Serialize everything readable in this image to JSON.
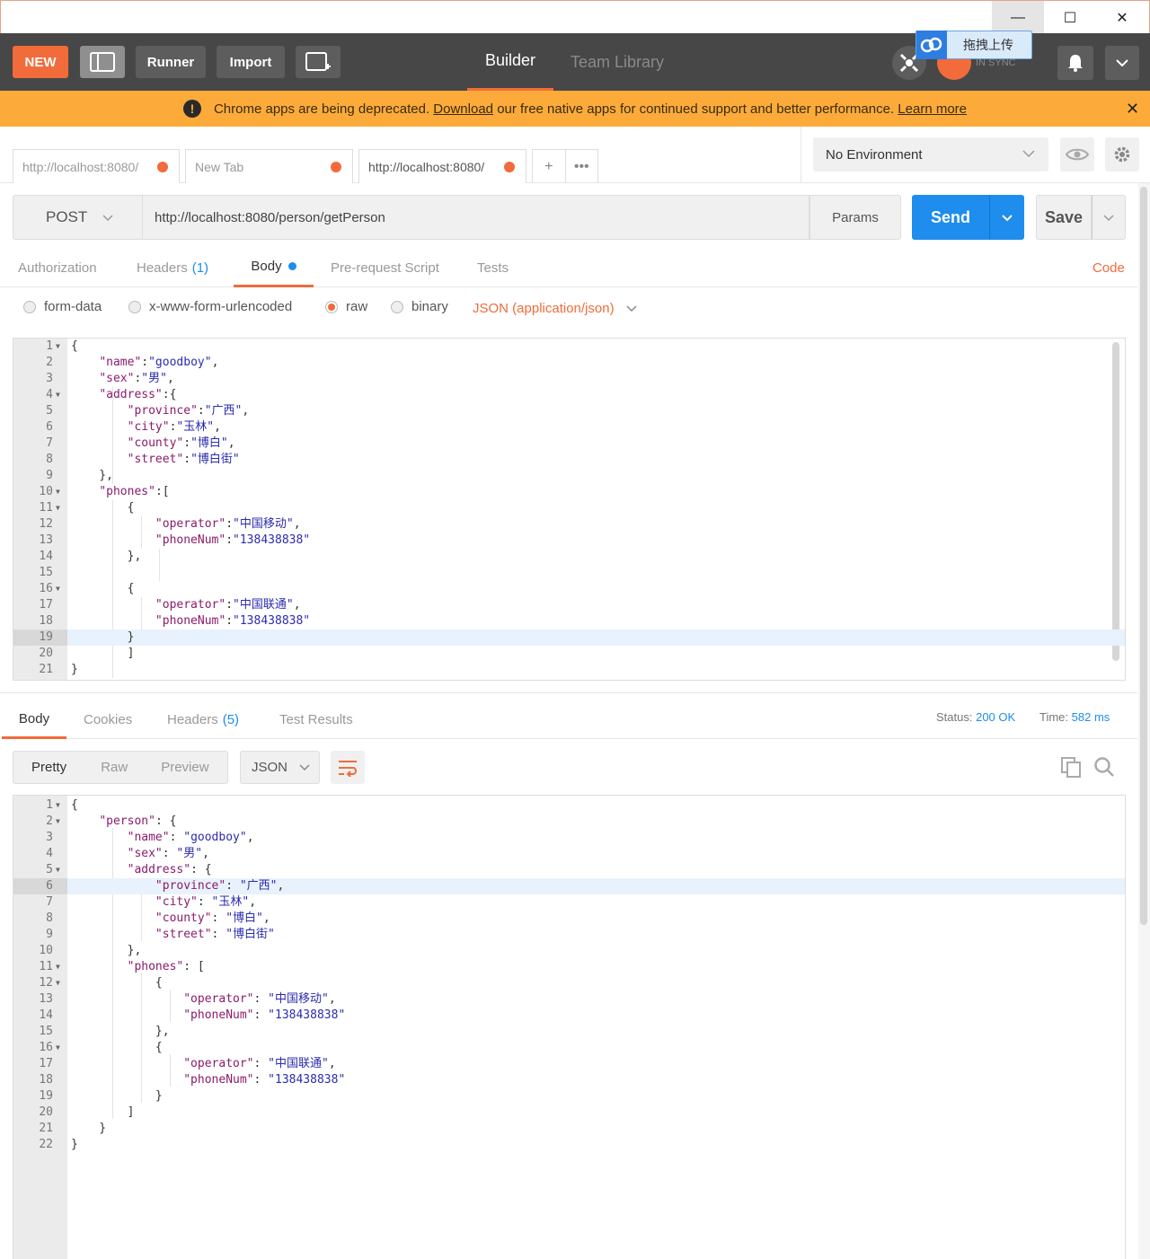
{
  "window": {
    "minimize": "—",
    "maximize": "☐",
    "close": "✕"
  },
  "header": {
    "new_label": "NEW",
    "runner_label": "Runner",
    "import_label": "Import",
    "tabs": [
      "Builder",
      "Team Library"
    ],
    "sync_text": "IN SYNC",
    "overlay_text": "拖拽上传"
  },
  "banner": {
    "text_before": "Chrome apps are being deprecated.",
    "download_link": "Download",
    "text_after": "our free native apps for continued support and better performance.",
    "learn_more": "Learn more"
  },
  "request_tabs": [
    {
      "label": "http://localhost:8080/"
    },
    {
      "label": "New Tab"
    },
    {
      "label": "http://localhost:8080/"
    }
  ],
  "environment": {
    "selected": "No Environment"
  },
  "request": {
    "method": "POST",
    "url": "http://localhost:8080/person/getPerson",
    "params_label": "Params",
    "send_label": "Send",
    "save_label": "Save"
  },
  "request_sections": {
    "authorization": "Authorization",
    "headers": "Headers",
    "headers_count": "(1)",
    "body": "Body",
    "prerequest": "Pre-request Script",
    "tests": "Tests",
    "code": "Code"
  },
  "body_modes": {
    "form_data": "form-data",
    "urlencoded": "x-www-form-urlencoded",
    "raw": "raw",
    "binary": "binary",
    "content_type": "JSON (application/json)"
  },
  "request_body_lines": [
    {
      "n": "1",
      "fold": true,
      "html": "{"
    },
    {
      "n": "2",
      "html": "    <span class='k'>\"name\"</span>:<span class='s'>\"goodboy\"</span>,"
    },
    {
      "n": "3",
      "html": "    <span class='k'>\"sex\"</span>:<span class='s'>\"男\"</span>,"
    },
    {
      "n": "4",
      "fold": true,
      "html": "    <span class='k'>\"address\"</span>:{"
    },
    {
      "n": "5",
      "html": "        <span class='k'>\"province\"</span>:<span class='s'>\"广西\"</span>,"
    },
    {
      "n": "6",
      "html": "        <span class='k'>\"city\"</span>:<span class='s'>\"玉林\"</span>,"
    },
    {
      "n": "7",
      "html": "        <span class='k'>\"county\"</span>:<span class='s'>\"博白\"</span>,"
    },
    {
      "n": "8",
      "html": "        <span class='k'>\"street\"</span>:<span class='s'>\"博白街\"</span>"
    },
    {
      "n": "9",
      "html": "    },"
    },
    {
      "n": "10",
      "fold": true,
      "html": "    <span class='k'>\"phones\"</span>:["
    },
    {
      "n": "11",
      "fold": true,
      "html": "        {"
    },
    {
      "n": "12",
      "html": "            <span class='k'>\"operator\"</span>:<span class='s'>\"中国移动\"</span>,"
    },
    {
      "n": "13",
      "html": "            <span class='k'>\"phoneNum\"</span>:<span class='s'>\"138438838\"</span>"
    },
    {
      "n": "14",
      "html": "        },"
    },
    {
      "n": "15",
      "html": ""
    },
    {
      "n": "16",
      "fold": true,
      "html": "        {"
    },
    {
      "n": "17",
      "html": "            <span class='k'>\"operator\"</span>:<span class='s'>\"中国联通\"</span>,"
    },
    {
      "n": "18",
      "html": "            <span class='k'>\"phoneNum\"</span>:<span class='s'>\"138438838\"</span>"
    },
    {
      "n": "19",
      "hl": true,
      "html": "        }"
    },
    {
      "n": "20",
      "html": "        ]"
    },
    {
      "n": "21",
      "html": "}"
    }
  ],
  "response_sections": {
    "body": "Body",
    "cookies": "Cookies",
    "headers": "Headers",
    "headers_count": "(5)",
    "test_results": "Test Results",
    "status_label": "Status:",
    "status_value": "200 OK",
    "time_label": "Time:",
    "time_value": "582 ms"
  },
  "response_format": {
    "pretty": "Pretty",
    "raw": "Raw",
    "preview": "Preview",
    "language": "JSON"
  },
  "response_body_lines": [
    {
      "n": "1",
      "fold": true,
      "html": "{"
    },
    {
      "n": "2",
      "fold": true,
      "html": "    <span class='k'>\"person\"</span>: {"
    },
    {
      "n": "3",
      "html": "        <span class='k'>\"name\"</span>: <span class='s'>\"goodboy\"</span>,"
    },
    {
      "n": "4",
      "html": "        <span class='k'>\"sex\"</span>: <span class='s'>\"男\"</span>,"
    },
    {
      "n": "5",
      "fold": true,
      "html": "        <span class='k'>\"address\"</span>: {"
    },
    {
      "n": "6",
      "hl": true,
      "html": "            <span class='k'>\"province\"</span>: <span class='s'>\"广西\"</span>,"
    },
    {
      "n": "7",
      "html": "            <span class='k'>\"city\"</span>: <span class='s'>\"玉林\"</span>,"
    },
    {
      "n": "8",
      "html": "            <span class='k'>\"county\"</span>: <span class='s'>\"博白\"</span>,"
    },
    {
      "n": "9",
      "html": "            <span class='k'>\"street\"</span>: <span class='s'>\"博白街\"</span>"
    },
    {
      "n": "10",
      "html": "        },"
    },
    {
      "n": "11",
      "fold": true,
      "html": "        <span class='k'>\"phones\"</span>: ["
    },
    {
      "n": "12",
      "fold": true,
      "html": "            {"
    },
    {
      "n": "13",
      "html": "                <span class='k'>\"operator\"</span>: <span class='s'>\"中国移动\"</span>,"
    },
    {
      "n": "14",
      "html": "                <span class='k'>\"phoneNum\"</span>: <span class='s'>\"138438838\"</span>"
    },
    {
      "n": "15",
      "html": "            },"
    },
    {
      "n": "16",
      "fold": true,
      "html": "            {"
    },
    {
      "n": "17",
      "html": "                <span class='k'>\"operator\"</span>: <span class='s'>\"中国联通\"</span>,"
    },
    {
      "n": "18",
      "html": "                <span class='k'>\"phoneNum\"</span>: <span class='s'>\"138438838\"</span>"
    },
    {
      "n": "19",
      "html": "            }"
    },
    {
      "n": "20",
      "html": "        ]"
    },
    {
      "n": "21",
      "html": "    }"
    },
    {
      "n": "22",
      "html": "}"
    }
  ],
  "colors": {
    "accent": "#f26b3a",
    "send": "#1e8ded",
    "banner": "#fcab3a",
    "header": "#474747"
  }
}
